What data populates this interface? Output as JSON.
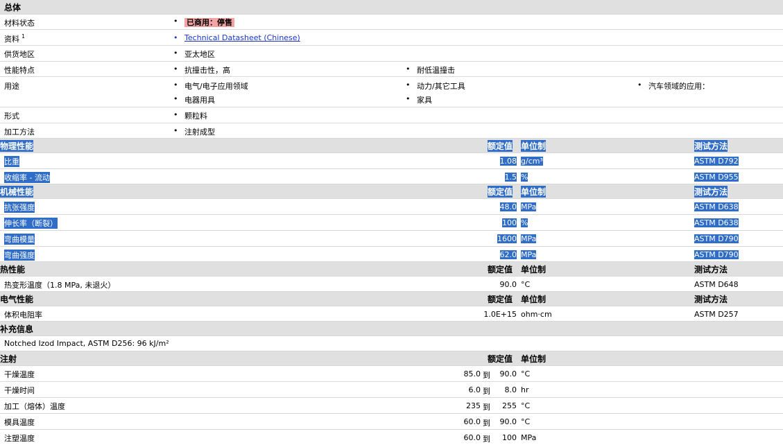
{
  "general": {
    "title": "总体",
    "rows": [
      {
        "label": "材料状态",
        "items": [
          "已商用：停售"
        ]
      },
      {
        "label": "资料",
        "sup": "1",
        "items": [
          "Technical Datasheet (Chinese)"
        ]
      },
      {
        "label": "供货地区",
        "items": [
          "亚太地区"
        ]
      },
      {
        "label": "性能特点",
        "items": [
          "抗撞击性，高",
          "耐低温撞击"
        ]
      },
      {
        "label": "用途",
        "items": [
          "电气/电子应用领域",
          "动力/其它工具",
          "汽车领域的应用：",
          "电器用具",
          "家具"
        ]
      },
      {
        "label": "形式",
        "items": [
          "颗粒料"
        ]
      },
      {
        "label": "加工方法",
        "items": [
          "注射成型"
        ]
      }
    ]
  },
  "headers": {
    "nominal": "额定值",
    "unit": "单位制",
    "method": "测试方法"
  },
  "physical": {
    "title": "物理性能",
    "rows": [
      {
        "label": "比重",
        "value": "1.08",
        "unit": "g/cm³",
        "method": "ASTM D792"
      },
      {
        "label": "收缩率 - 流动",
        "value": "1.5",
        "unit": "%",
        "method": "ASTM D955"
      }
    ]
  },
  "mechanical": {
    "title": "机械性能",
    "rows": [
      {
        "label": "抗张强度",
        "value": "48.0",
        "unit": "MPa",
        "method": "ASTM D638"
      },
      {
        "label": "伸长率（断裂）",
        "value": "100",
        "unit": "%",
        "method": "ASTM D638"
      },
      {
        "label": "弯曲模量",
        "value": "1600",
        "unit": "MPa",
        "method": "ASTM D790"
      },
      {
        "label": "弯曲强度",
        "value": "62.0",
        "unit": "MPa",
        "method": "ASTM D790"
      }
    ]
  },
  "thermal": {
    "title": "热性能",
    "rows": [
      {
        "label": "热变形温度（1.8 MPa, 未退火）",
        "value": "90.0",
        "unit": "°C",
        "method": "ASTM D648"
      }
    ]
  },
  "electrical": {
    "title": "电气性能",
    "rows": [
      {
        "label": "体积电阻率",
        "value": "1.0E+15",
        "unit": "ohm·cm",
        "method": "ASTM D257"
      }
    ]
  },
  "additional": {
    "title": "补充信息",
    "text": "Notched Izod Impact, ASTM D256: 96 kJ/m²"
  },
  "injection": {
    "title": "注射",
    "rows": [
      {
        "label": "干燥温度",
        "from": "85.0",
        "to_word": "到",
        "to": "90.0",
        "unit": "°C"
      },
      {
        "label": "干燥时间",
        "from": "6.0",
        "to_word": "到",
        "to": "8.0",
        "unit": "hr"
      },
      {
        "label": "加工（熔体）温度",
        "from": "235",
        "to_word": "到",
        "to": "255",
        "unit": "°C"
      },
      {
        "label": "模具温度",
        "from": "60.0",
        "to_word": "到",
        "to": "90.0",
        "unit": "°C"
      },
      {
        "label": "注塑温度",
        "from": "60.0",
        "to_word": "到",
        "to": "100",
        "unit": "MPa"
      }
    ]
  }
}
